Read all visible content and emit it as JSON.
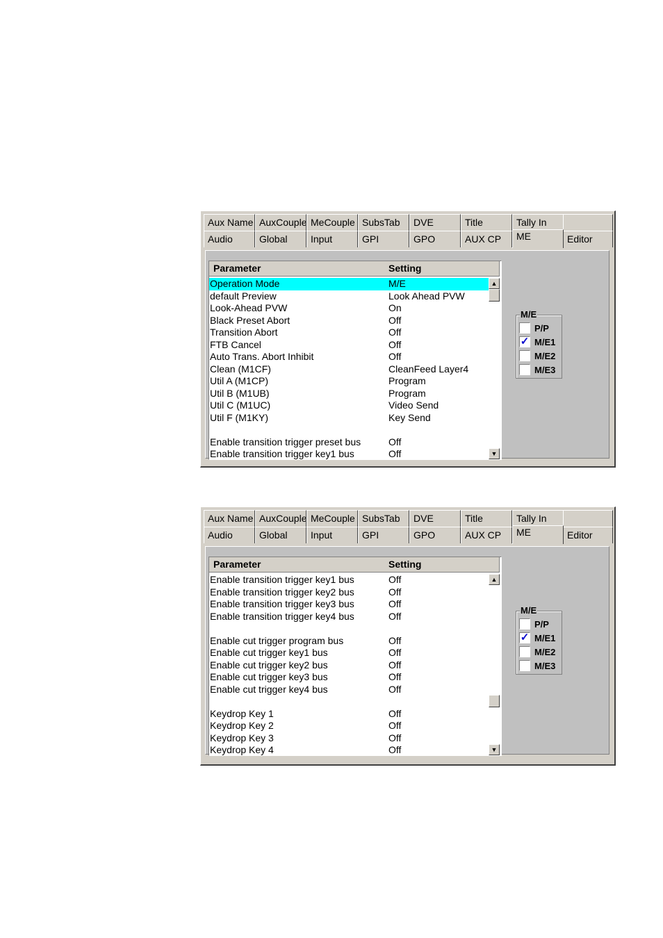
{
  "tabs_row1": [
    "Aux Name",
    "AuxCouple",
    "MeCouple",
    "SubsTab",
    "DVE",
    "Title",
    "Tally In",
    ""
  ],
  "tabs_row2": [
    "Audio",
    "Global",
    "Input",
    "GPI",
    "GPO",
    "AUX CP",
    "ME",
    "Editor"
  ],
  "active_tab": "ME",
  "list_header": {
    "parameter": "Parameter",
    "setting": "Setting"
  },
  "panel1": {
    "rows": [
      {
        "param": "Operation Mode",
        "setting": "M/E",
        "selected": true
      },
      {
        "param": "default Preview",
        "setting": "Look Ahead PVW"
      },
      {
        "param": "Look-Ahead PVW",
        "setting": "On"
      },
      {
        "param": "Black Preset Abort",
        "setting": "Off"
      },
      {
        "param": "Transition Abort",
        "setting": "Off"
      },
      {
        "param": "FTB Cancel",
        "setting": "Off"
      },
      {
        "param": "Auto Trans. Abort Inhibit",
        "setting": "Off"
      },
      {
        "param": "Clean (M1CF)",
        "setting": "CleanFeed Layer4"
      },
      {
        "param": "Util A (M1CP)",
        "setting": "Program"
      },
      {
        "param": "Util B (M1UB)",
        "setting": "Program"
      },
      {
        "param": "Util C (M1UC)",
        "setting": "Video Send"
      },
      {
        "param": "Util F (M1KY)",
        "setting": "Key Send"
      },
      {
        "param": "",
        "setting": ""
      },
      {
        "param": "Enable transition trigger preset bus",
        "setting": "Off"
      },
      {
        "param": "Enable transition trigger key1 bus",
        "setting": "Off"
      }
    ],
    "scroll_position": 0.0
  },
  "panel2": {
    "rows": [
      {
        "param": "Enable transition trigger key1 bus",
        "setting": "Off"
      },
      {
        "param": "Enable transition trigger key2 bus",
        "setting": "Off"
      },
      {
        "param": "Enable transition trigger key3 bus",
        "setting": "Off"
      },
      {
        "param": "Enable transition trigger key4 bus",
        "setting": "Off"
      },
      {
        "param": "",
        "setting": ""
      },
      {
        "param": "Enable cut trigger program bus",
        "setting": "Off"
      },
      {
        "param": "Enable cut trigger key1 bus",
        "setting": "Off"
      },
      {
        "param": "Enable cut trigger key2 bus",
        "setting": "Off"
      },
      {
        "param": "Enable cut trigger key3 bus",
        "setting": "Off"
      },
      {
        "param": "Enable cut trigger key4 bus",
        "setting": "Off"
      },
      {
        "param": "",
        "setting": ""
      },
      {
        "param": "Keydrop Key 1",
        "setting": "Off"
      },
      {
        "param": "Keydrop Key 2",
        "setting": "Off"
      },
      {
        "param": "Keydrop Key 3",
        "setting": "Off"
      },
      {
        "param": "Keydrop Key 4",
        "setting": "Off"
      }
    ],
    "scroll_position": 0.75
  },
  "me_group": {
    "title": "M/E",
    "options": [
      {
        "label": "P/P",
        "checked": false
      },
      {
        "label": "M/E1",
        "checked": true
      },
      {
        "label": "M/E2",
        "checked": false
      },
      {
        "label": "M/E3",
        "checked": false
      }
    ]
  },
  "icons": {
    "up": "scroll-up-arrow-icon",
    "down": "scroll-down-arrow-icon",
    "check": "checkmark-icon"
  },
  "colors": {
    "selection": "#00ffff",
    "face": "#d4d0c8",
    "check": "#0000cc"
  }
}
